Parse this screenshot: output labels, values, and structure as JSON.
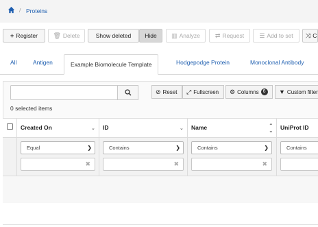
{
  "breadcrumb": {
    "current": "Proteins",
    "separator": "/"
  },
  "toolbar": {
    "register": "Register",
    "delete": "Delete",
    "show_deleted": "Show deleted",
    "hide": "Hide",
    "analyze": "Analyze",
    "request": "Request",
    "add_to_set": "Add to set",
    "compare": "C"
  },
  "tabs": [
    "All",
    "Antigen",
    "Example Biomolecule Template",
    "Hodgepodge Protein",
    "Monoclonal Antibody"
  ],
  "table_tools": {
    "reset": "Reset",
    "fullscreen": "Fullscreen",
    "columns": "Columns",
    "columns_count": "6",
    "custom_filter": "Custom filter"
  },
  "selection": {
    "text": "0 selected items"
  },
  "columns": [
    {
      "label": "Created On",
      "filter": "Equal"
    },
    {
      "label": "ID",
      "filter": "Contains"
    },
    {
      "label": "Name",
      "filter": "Contains"
    },
    {
      "label": "UniProt ID",
      "filter": "Contains"
    }
  ]
}
